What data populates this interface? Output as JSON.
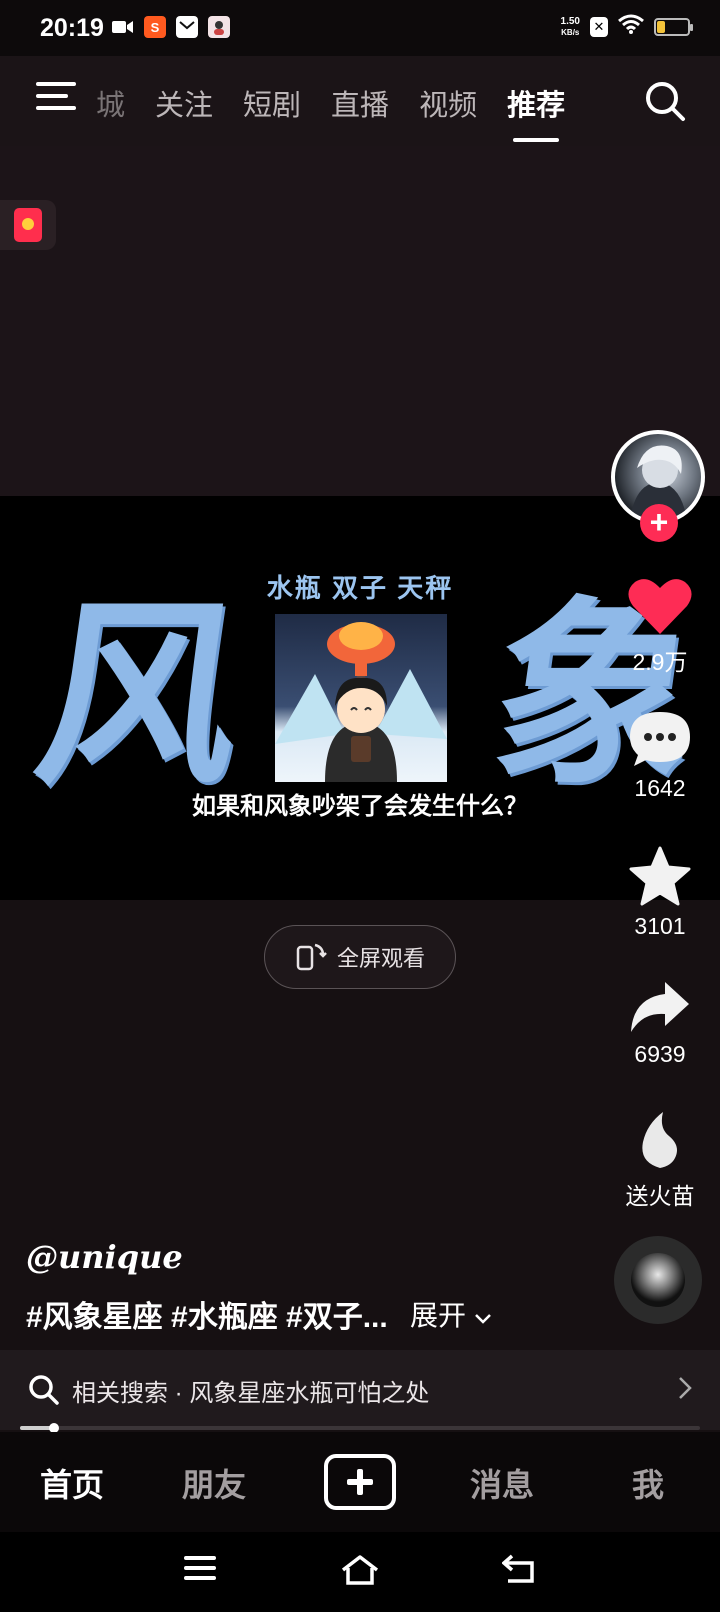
{
  "status_bar": {
    "time": "20:19",
    "net_speed_value": "1.50",
    "net_speed_unit": "KB/s",
    "battery_percent": 0.25
  },
  "top_nav": {
    "tabs": [
      "城",
      "关注",
      "短剧",
      "直播",
      "视频",
      "推荐"
    ],
    "active_tab": "推荐"
  },
  "video": {
    "left_big_char": "风",
    "right_big_char": "象",
    "signs_line": "水瓶 双子 天秤",
    "caption": "如果和风象吵架了会发生什么？"
  },
  "fullscreen_button": {
    "label": "全屏观看"
  },
  "actions": {
    "likes": "2.9万",
    "comments": "1642",
    "favorites": "3101",
    "shares": "6939",
    "gift_label": "送火苗",
    "colors": {
      "like": "#fe2c55",
      "follow": "#fe2c55"
    }
  },
  "post": {
    "author": "@unique",
    "hashtags": "#风象星座 #水瓶座 #双子...",
    "expand_label": "展开"
  },
  "related_search": {
    "text": "相关搜索 · 风象星座水瓶可怕之处"
  },
  "playback": {
    "progress": 0.05
  },
  "bottom_nav": {
    "home": "首页",
    "friends": "朋友",
    "messages": "消息",
    "me": "我"
  }
}
